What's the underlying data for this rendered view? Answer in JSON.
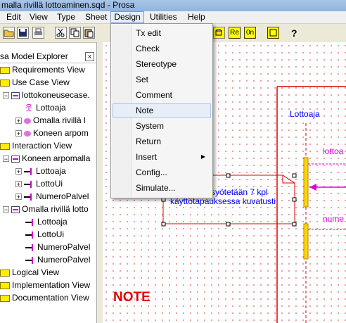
{
  "window": {
    "title": "malla rivillä lottoaminen.sqd - Prosa"
  },
  "menubar": {
    "items": [
      {
        "label": "Edit"
      },
      {
        "label": "View"
      },
      {
        "label": "Type"
      },
      {
        "label": "Sheet"
      },
      {
        "label": "Design"
      },
      {
        "label": "Utilities"
      },
      {
        "label": "Help"
      }
    ]
  },
  "toolbar": {
    "yellow_buttons": [
      "Re",
      "0n"
    ]
  },
  "explorer": {
    "title": "sa Model Explorer",
    "close": "x",
    "tree": [
      "Requirements View",
      "Use Case View",
      "lottokoneusecase.",
      "Lottoaja",
      "Omalla rivillä l",
      "Koneen arpom",
      "Interaction View",
      "Koneen arpomalla",
      "Lottoaja",
      "LottoUi",
      "NumeroPalvel",
      "Omalla rivillä lotto",
      "Lottoaja",
      "LottoUi",
      "NumeroPalvel",
      "NumeroPalvel",
      "Logical View",
      "Implementation View",
      "Documentation View"
    ]
  },
  "design_menu": {
    "items": [
      {
        "label": "Tx edit"
      },
      {
        "label": "Check"
      },
      {
        "label": "Stereotype"
      },
      {
        "label": "Set"
      },
      {
        "label": "Comment"
      },
      {
        "label": "Note"
      },
      {
        "label": "System"
      },
      {
        "label": "Return"
      },
      {
        "label": "Insert",
        "submenu_arrow": "▶"
      },
      {
        "label": "Config..."
      },
      {
        "label": "Simulate..."
      }
    ]
  },
  "diagram": {
    "lifeline_label": "Lottoaja",
    "msg1": "lottoa",
    "msg2": "nume",
    "note_line1": "a syötetään 7 kpl",
    "note_line2": "käyttötapauksessa kuvatusti",
    "annotation": "NOTE"
  },
  "colors": {
    "accent_red": "#e00000",
    "diagram_blue": "#0000ff",
    "message_magenta": "#dd00dd",
    "activation_yellow": "#ffd700"
  }
}
